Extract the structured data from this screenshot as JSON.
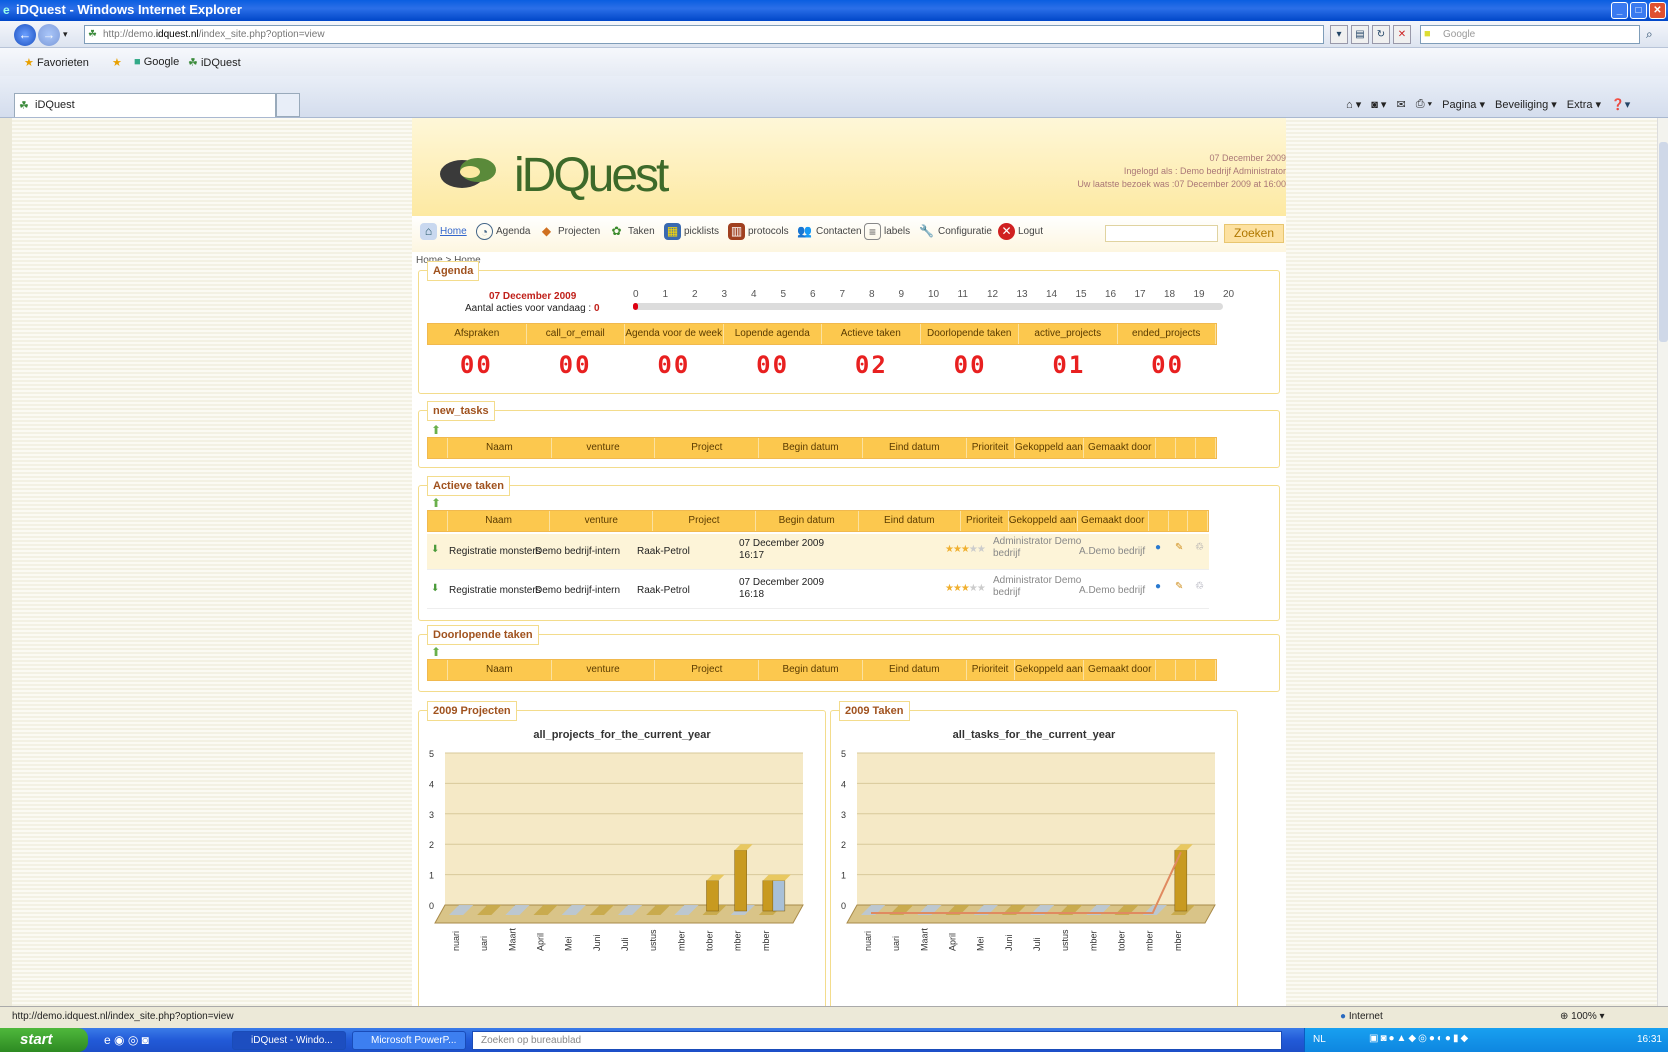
{
  "window": {
    "title": "iDQuest - Windows Internet Explorer"
  },
  "browser": {
    "url_prefix": "http://demo.",
    "url_domain": "idquest.nl",
    "url_path": "/index_site.php?option=view",
    "search_placeholder": "Google",
    "favorites_label": "Favorieten",
    "fav_links": [
      "Google",
      "iDQuest"
    ],
    "tab_label": "iDQuest",
    "cmd": {
      "page": "Pagina ▾",
      "security": "Beveiliging ▾",
      "extra": "Extra ▾"
    }
  },
  "header": {
    "logo": "iDQuest",
    "date": "07 December 2009",
    "logged_in": "Ingelogd als : Demo bedrijf Administrator",
    "last_visit": "Uw laatste bezoek was :07 December 2009 at 16:00"
  },
  "menu": {
    "items": [
      "Home",
      "Agenda",
      "Projecten",
      "Taken",
      "picklists",
      "protocols",
      "Contacten",
      "labels",
      "Configuratie",
      "Logut"
    ],
    "search_button": "Zoeken"
  },
  "breadcrumb": "Home > Home",
  "agenda": {
    "legend": "Agenda",
    "date": "07 December 2009",
    "actions_label": "Aantal acties voor vandaag : ",
    "actions_count": "0",
    "hours": [
      "0",
      "1",
      "2",
      "3",
      "4",
      "5",
      "6",
      "7",
      "8",
      "9",
      "10",
      "11",
      "12",
      "13",
      "14",
      "15",
      "16",
      "17",
      "18",
      "19",
      "20"
    ],
    "stat_labels": [
      "Afspraken",
      "call_or_email",
      "Agenda voor de week",
      "Lopende agenda",
      "Actieve taken",
      "Doorlopende taken",
      "active_projects",
      "ended_projects"
    ],
    "stat_values": [
      "00",
      "00",
      "00",
      "00",
      "02",
      "00",
      "01",
      "00"
    ]
  },
  "new_tasks": {
    "legend": "new_tasks",
    "columns": [
      "",
      "Naam",
      "venture",
      "Project",
      "Begin datum",
      "Eind datum",
      "Prioriteit",
      "Gekoppeld aan",
      "Gemaakt door",
      "",
      "",
      ""
    ]
  },
  "active_tasks": {
    "legend": "Actieve taken",
    "columns": [
      "",
      "Naam",
      "venture",
      "Project",
      "Begin datum",
      "Eind datum",
      "Prioriteit",
      "Gekoppeld aan",
      "Gemaakt door",
      "",
      "",
      ""
    ],
    "rows": [
      {
        "name": "Registratie monsters",
        "venture": "Demo bedrijf-intern",
        "project": "Raak-Petrol",
        "begin_date": "07 December 2009",
        "begin_time": "16:17",
        "end": "",
        "priority": 3,
        "linked_1": "Administrator Demo",
        "linked_2": "bedrijf",
        "created_by": "A.Demo bedrijf"
      },
      {
        "name": "Registratie monsters",
        "venture": "Demo bedrijf-intern",
        "project": "Raak-Petrol",
        "begin_date": "07 December 2009",
        "begin_time": "16:18",
        "end": "",
        "priority": 3,
        "linked_1": "Administrator Demo",
        "linked_2": "bedrijf",
        "created_by": "A.Demo bedrijf"
      }
    ]
  },
  "running_tasks": {
    "legend": "Doorlopende taken",
    "columns": [
      "",
      "Naam",
      "venture",
      "Project",
      "Begin datum",
      "Eind datum",
      "Prioriteit",
      "Gekoppeld aan",
      "Gemaakt door",
      "",
      "",
      ""
    ]
  },
  "chart_data": [
    {
      "type": "bar",
      "legend": "2009 Projecten",
      "title": "all_projects_for_the_current_year",
      "categories": [
        "nuari",
        "uari",
        "Maart",
        "April",
        "Mei",
        "Juni",
        "Juli",
        "ustus",
        "mber",
        "tober",
        "mber",
        "mber"
      ],
      "series": [
        {
          "values": [
            0,
            0,
            0,
            0,
            0,
            0,
            0,
            0,
            0,
            1,
            2,
            1
          ]
        },
        {
          "values": [
            0,
            0,
            0,
            0,
            0,
            0,
            0,
            0,
            0,
            0,
            0,
            1
          ]
        }
      ],
      "ylim": [
        0,
        5
      ],
      "yticks": [
        "0",
        "1",
        "2",
        "3",
        "4",
        "5"
      ]
    },
    {
      "type": "bar",
      "legend": "2009 Taken",
      "title": "all_tasks_for_the_current_year",
      "categories": [
        "nuari",
        "uari",
        "Maart",
        "April",
        "Mei",
        "Juni",
        "Juli",
        "ustus",
        "mber",
        "tober",
        "mber",
        "mber"
      ],
      "series": [
        {
          "values": [
            0,
            0,
            0,
            0,
            0,
            0,
            0,
            0,
            0,
            0,
            0,
            2
          ]
        }
      ],
      "ylim": [
        0,
        5
      ],
      "yticks": [
        "0",
        "1",
        "2",
        "3",
        "4",
        "5"
      ]
    }
  ],
  "status": {
    "url": "http://demo.idquest.nl/index_site.php?option=view",
    "zone": "Internet",
    "zoom": "100%"
  },
  "taskbar": {
    "start": "start",
    "buttons": [
      "iDQuest - Windo...",
      "Microsoft PowerP..."
    ],
    "search": "Zoeken op bureaublad",
    "lang": "NL",
    "clock": "16:31"
  }
}
